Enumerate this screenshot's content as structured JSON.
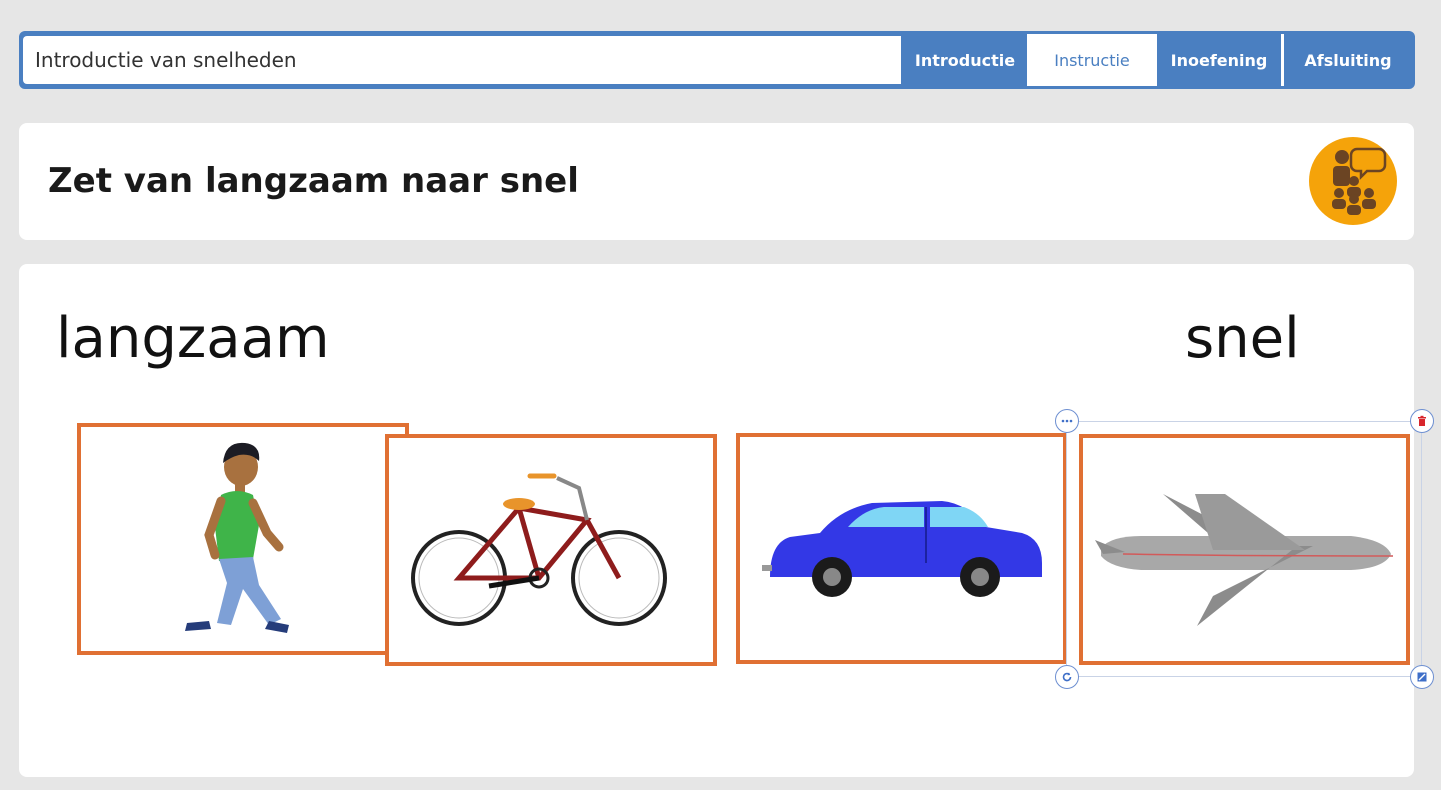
{
  "header": {
    "lesson_title": "Introductie van snelheden",
    "tabs": [
      {
        "label": "Introductie",
        "active": false
      },
      {
        "label": "Instructie",
        "active": true
      },
      {
        "label": "Inoefening",
        "active": false
      },
      {
        "label": "Afsluiting",
        "active": false
      }
    ]
  },
  "slide": {
    "heading": "Zet van langzaam naar snel",
    "icon": "teacher-instruction-icon",
    "icon_color": "#f5a30a"
  },
  "content": {
    "label_left": "langzaam",
    "label_right": "snel",
    "cards": [
      {
        "image": "walking-boy-image"
      },
      {
        "image": "bicycle-image"
      },
      {
        "image": "blue-car-image"
      },
      {
        "image": "airplane-image"
      }
    ],
    "card_border_color": "#e07033",
    "selection_handles": [
      "more-options-icon",
      "delete-icon",
      "rotate-icon",
      "resize-icon"
    ]
  }
}
